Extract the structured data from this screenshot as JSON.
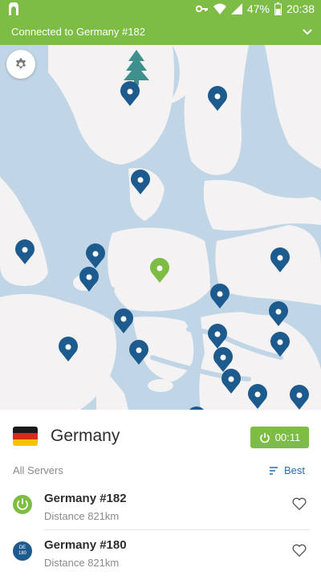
{
  "status_bar": {
    "battery_percent": "47%",
    "time": "20:38",
    "icons": [
      "app-logo-icon",
      "key-icon",
      "wifi-icon",
      "signal-icon",
      "battery-icon"
    ]
  },
  "connection_bar": {
    "text": "Connected to Germany #182",
    "icon": "chevron-down-icon"
  },
  "map": {
    "settings_icon": "gear-icon",
    "pins": [
      {
        "name": "server-pin-1",
        "state": "available"
      },
      {
        "name": "server-pin-2",
        "state": "available"
      },
      {
        "name": "server-pin-3",
        "state": "available"
      },
      {
        "name": "server-pin-4",
        "state": "available"
      },
      {
        "name": "server-pin-5",
        "state": "available"
      },
      {
        "name": "server-pin-6",
        "state": "available"
      },
      {
        "name": "server-pin-germany",
        "state": "connected"
      },
      {
        "name": "server-pin-8",
        "state": "available"
      },
      {
        "name": "server-pin-9",
        "state": "available"
      },
      {
        "name": "server-pin-10",
        "state": "available"
      },
      {
        "name": "server-pin-11",
        "state": "available"
      },
      {
        "name": "server-pin-12",
        "state": "available"
      },
      {
        "name": "server-pin-13",
        "state": "available"
      },
      {
        "name": "server-pin-14",
        "state": "available"
      },
      {
        "name": "server-pin-15",
        "state": "available"
      },
      {
        "name": "server-pin-16",
        "state": "available"
      },
      {
        "name": "server-pin-17",
        "state": "available"
      },
      {
        "name": "server-pin-18",
        "state": "available"
      },
      {
        "name": "server-pin-19",
        "state": "available"
      }
    ]
  },
  "panel": {
    "country": "Germany",
    "timer": "00:11",
    "all_servers_label": "All Servers",
    "sort_label": "Best",
    "servers": [
      {
        "name": "Germany #182",
        "distance": "Distance 821km",
        "status": "connected"
      },
      {
        "name": "Germany #180",
        "distance": "Distance 821km",
        "status": "available",
        "badge_code": "DE",
        "badge_number": "180"
      }
    ]
  },
  "colors": {
    "accent_green": "#7ebd45",
    "pin_blue": "#1d5b8f",
    "water": "#c0d6e6",
    "land": "#f4f2f3",
    "link_blue": "#2a6aa8"
  }
}
